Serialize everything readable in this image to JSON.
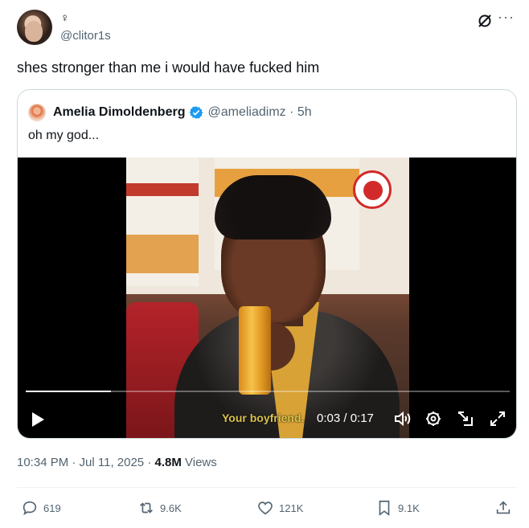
{
  "author": {
    "display_name": "♀",
    "handle": "@clitor1s"
  },
  "tweet": {
    "text": "shes stronger than me i would have fucked him",
    "timestamp": "10:34 PM · Jul 11, 2025 · ",
    "views_count": "4.8M",
    "views_label": " Views"
  },
  "quote": {
    "display_name": "Amelia Dimoldenberg",
    "handle": "@ameliadimz · 5h",
    "text": "oh my god..."
  },
  "video": {
    "subtitle": "Your boyfriend.",
    "time": "0:03 / 0:17",
    "progress_fraction": 0.176
  },
  "actions": {
    "replies": "619",
    "reposts": "9.6K",
    "likes": "121K",
    "bookmarks": "9.1K"
  },
  "icons": {
    "more": "more-horizontal-icon",
    "grok": "grok-icon",
    "verified": "verified-badge-icon",
    "play": "play-icon",
    "volume": "volume-icon",
    "settings": "settings-icon",
    "minimize": "picture-in-picture-icon",
    "fullscreen": "fullscreen-icon",
    "reply": "reply-icon",
    "repost": "repost-icon",
    "like": "like-icon",
    "bookmark": "bookmark-icon",
    "share": "share-icon"
  },
  "colors": {
    "verified": "#1d9bf0",
    "secondary_text": "#536471",
    "primary_text": "#0f1419"
  }
}
